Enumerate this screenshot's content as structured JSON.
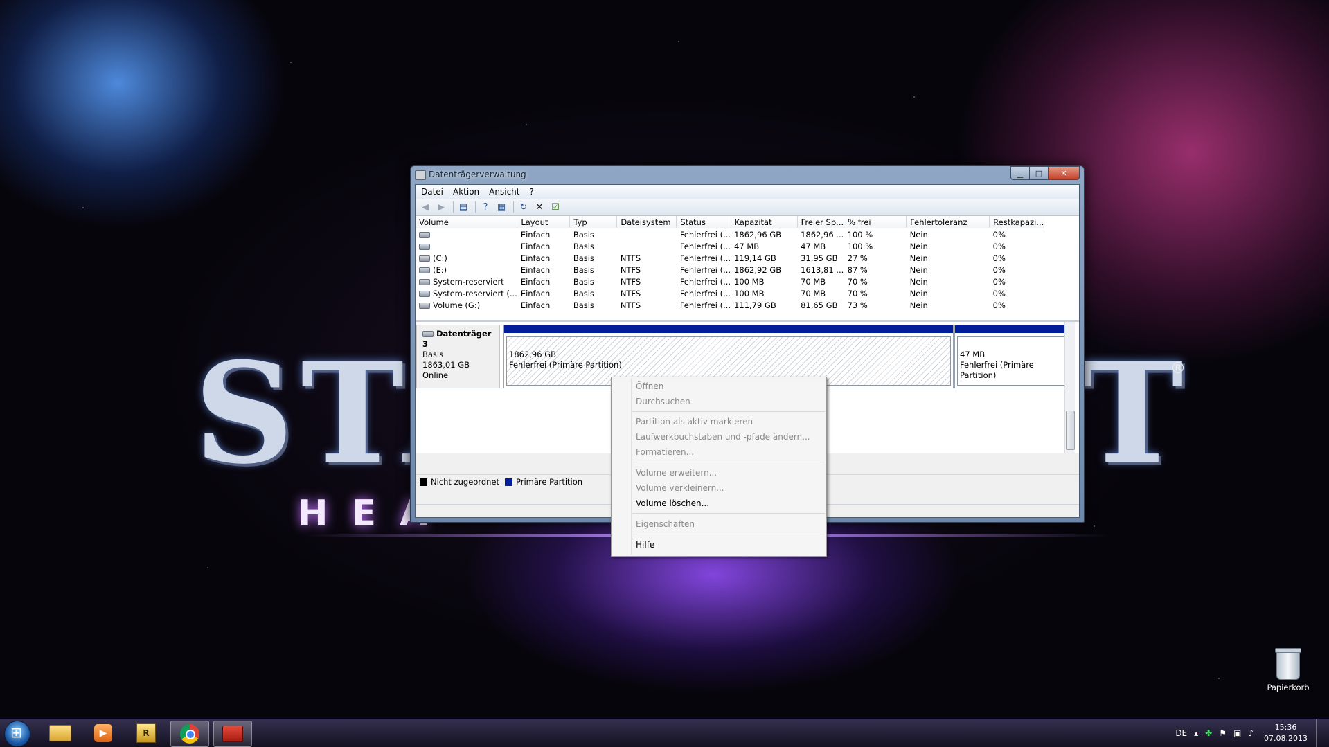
{
  "wallpaper": {
    "logo_left": "STA",
    "logo_right": "T",
    "subtitle": "HEA",
    "registered": "®"
  },
  "window": {
    "title": "Datenträgerverwaltung",
    "buttons": {
      "minimize": "▁",
      "maximize": "□",
      "close": "✕"
    },
    "menu": [
      "Datei",
      "Aktion",
      "Ansicht",
      "?"
    ],
    "toolbar_icons": [
      "back-icon",
      "forward-icon",
      "console-tree-icon",
      "help-icon",
      "properties-icon",
      "refresh-icon",
      "delete-icon",
      "check-icon"
    ]
  },
  "volumes": {
    "columns": [
      "Volume",
      "Layout",
      "Typ",
      "Dateisystem",
      "Status",
      "Kapazität",
      "Freier Sp...",
      "% frei",
      "Fehlertoleranz",
      "Restkapazi..."
    ],
    "rows": [
      [
        "",
        "Einfach",
        "Basis",
        "",
        "Fehlerfrei (...",
        "1862,96 GB",
        "1862,96 ...",
        "100 %",
        "Nein",
        "0%"
      ],
      [
        "",
        "Einfach",
        "Basis",
        "",
        "Fehlerfrei (...",
        "47 MB",
        "47 MB",
        "100 %",
        "Nein",
        "0%"
      ],
      [
        "(C:)",
        "Einfach",
        "Basis",
        "NTFS",
        "Fehlerfrei (...",
        "119,14 GB",
        "31,95 GB",
        "27 %",
        "Nein",
        "0%"
      ],
      [
        "(E:)",
        "Einfach",
        "Basis",
        "NTFS",
        "Fehlerfrei (...",
        "1862,92 GB",
        "1613,81 ...",
        "87 %",
        "Nein",
        "0%"
      ],
      [
        "System-reserviert",
        "Einfach",
        "Basis",
        "NTFS",
        "Fehlerfrei (...",
        "100 MB",
        "70 MB",
        "70 %",
        "Nein",
        "0%"
      ],
      [
        "System-reserviert (...",
        "Einfach",
        "Basis",
        "NTFS",
        "Fehlerfrei (...",
        "100 MB",
        "70 MB",
        "70 %",
        "Nein",
        "0%"
      ],
      [
        "Volume (G:)",
        "Einfach",
        "Basis",
        "NTFS",
        "Fehlerfrei (...",
        "111,79 GB",
        "81,65 GB",
        "73 %",
        "Nein",
        "0%"
      ]
    ]
  },
  "disk": {
    "name": "Datenträger 3",
    "type": "Basis",
    "size": "1863,01 GB",
    "state": "Online",
    "partitions": [
      {
        "size": "1862,96 GB",
        "status": "Fehlerfrei (Primäre Partition)"
      },
      {
        "size": "47 MB",
        "status": "Fehlerfrei (Primäre Partition)"
      }
    ]
  },
  "legend": [
    {
      "label": "Nicht zugeordnet",
      "color": "#000000"
    },
    {
      "label": "Primäre Partition",
      "color": "#001d9a"
    }
  ],
  "context_menu": {
    "items": [
      {
        "label": "Öffnen",
        "enabled": false
      },
      {
        "label": "Durchsuchen",
        "enabled": false
      },
      {
        "label": "Partition als aktiv markieren",
        "enabled": false
      },
      {
        "label": "Laufwerkbuchstaben und -pfade ändern...",
        "enabled": false
      },
      {
        "label": "Formatieren...",
        "enabled": false
      },
      {
        "label": "Volume erweitern...",
        "enabled": false
      },
      {
        "label": "Volume verkleinern...",
        "enabled": false
      },
      {
        "label": "Volume löschen...",
        "enabled": true
      },
      {
        "label": "Eigenschaften",
        "enabled": false
      },
      {
        "label": "Hilfe",
        "enabled": true
      }
    ]
  },
  "desktop": {
    "recycle_bin": "Papierkorb"
  },
  "taskbar": {
    "language": "DE",
    "time": "15:36",
    "date": "07.08.2013",
    "apps": [
      "explorer-icon",
      "media-player-icon",
      "rsyncro-icon",
      "chrome-icon",
      "disk-management-icon"
    ]
  }
}
